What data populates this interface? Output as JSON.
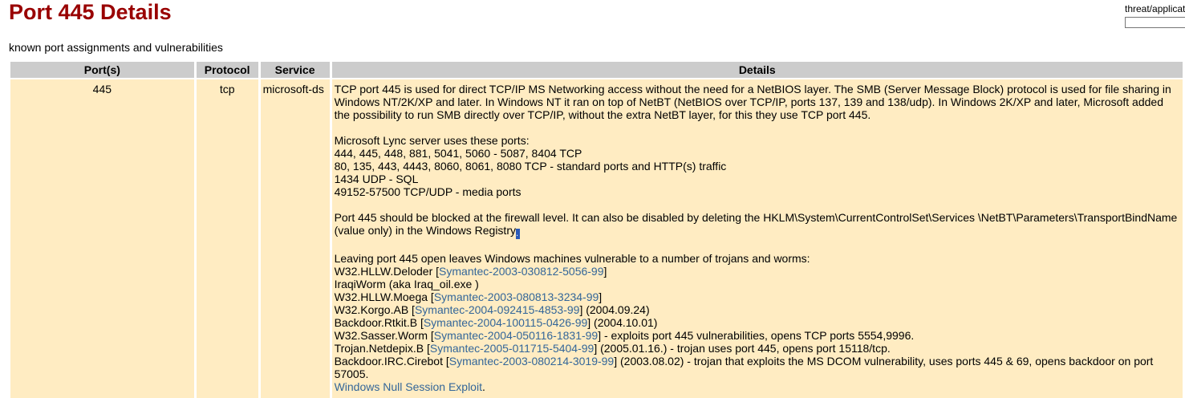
{
  "page": {
    "title": "Port 445 Details",
    "subtitle": "known port assignments and vulnerabilities",
    "search_label": "threat/applicat",
    "search_value": ""
  },
  "table": {
    "headers": {
      "ports": "Port(s)",
      "protocol": "Protocol",
      "service": "Service",
      "details": "Details"
    },
    "row": {
      "port": "445",
      "protocol": "tcp",
      "service": "microsoft-ds",
      "details": {
        "intro": "TCP port 445 is used for direct TCP/IP MS Networking access without the need for a NetBIOS layer. The SMB (Server Message Block) protocol is used for file sharing in Windows NT/2K/XP and later. In Windows NT it ran on top of NetBT (NetBIOS over TCP/IP, ports 137, 139 and 138/udp). In Windows 2K/XP and later, Microsoft added the possibility to run SMB directly over TCP/IP, without the extra NetBT layer, for this they use TCP port 445.",
        "lync_heading": "Microsoft Lync server uses these ports:",
        "lync_lines": [
          "444, 445, 448, 881, 5041, 5060 - 5087, 8404 TCP",
          "80, 135, 443, 4443, 8060, 8061, 8080 TCP - standard ports and HTTP(s) traffic",
          "1434 UDP - SQL",
          "49152-57500 TCP/UDP - media ports"
        ],
        "firewall_text": "Port 445 should be blocked at the firewall level. It can also be disabled by deleting the HKLM\\System\\CurrentControlSet\\Services \\NetBT\\Parameters\\TransportBindName (value only) in the Windows Registry",
        "firewall_end": ".",
        "trojans_intro": "Leaving port 445 open leaves Windows machines vulnerable to a number of trojans and worms:",
        "trojans": [
          {
            "name": "W32.HLLW.Deloder [",
            "ref": "Symantec-2003-030812-5056-99",
            "suffix": "]"
          },
          {
            "name": "IraqiWorm (aka Iraq_oil.exe )",
            "ref": "",
            "suffix": ""
          },
          {
            "name": "W32.HLLW.Moega [",
            "ref": "Symantec-2003-080813-3234-99",
            "suffix": "]"
          },
          {
            "name": "W32.Korgo.AB [",
            "ref": "Symantec-2004-092415-4853-99",
            "suffix": "] (2004.09.24)"
          },
          {
            "name": "Backdoor.Rtkit.B [",
            "ref": "Symantec-2004-100115-0426-99",
            "suffix": "] (2004.10.01)"
          },
          {
            "name": "W32.Sasser.Worm [",
            "ref": "Symantec-2004-050116-1831-99",
            "suffix": "] - exploits port 445 vulnerabilities, opens TCP ports 5554,9996."
          },
          {
            "name": "Trojan.Netdepix.B [",
            "ref": "Symantec-2005-011715-5404-99",
            "suffix": "] (2005.01.16.) - trojan uses port 445, opens port 15118/tcp."
          },
          {
            "name": "Backdoor.IRC.Cirebot [",
            "ref": "Symantec-2003-080214-3019-99",
            "suffix": "] (2003.08.02) - trojan that exploits the MS DCOM vulnerability, uses ports 445 & 69, opens backdoor on port 57005."
          }
        ],
        "exploit_link": "Windows Null Session Exploit",
        "exploit_end": "."
      }
    }
  },
  "colors": {
    "title": "#990000",
    "header_bg": "#cccccc",
    "row_bg": "#ffecc2",
    "link": "#336699"
  }
}
